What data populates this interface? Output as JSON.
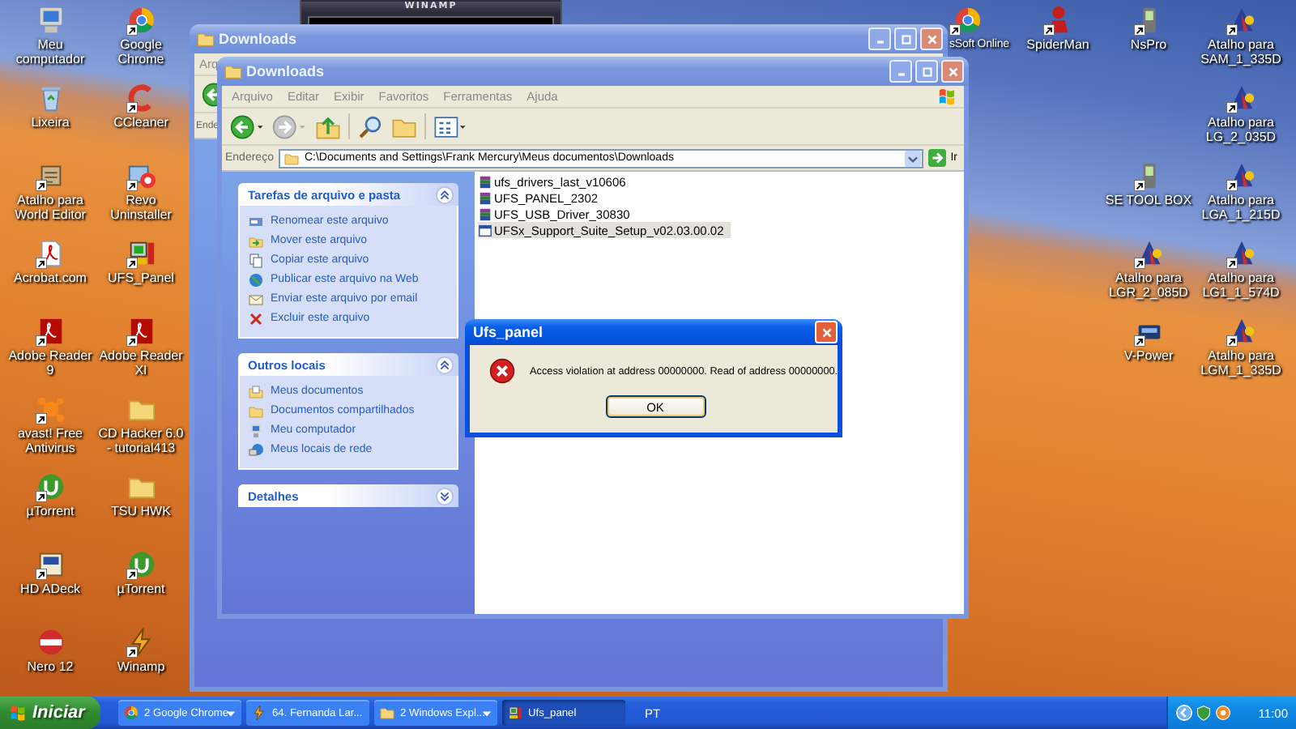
{
  "desktop_icons": [
    {
      "label": "Meu computador",
      "kind": "computer",
      "shortcut": false
    },
    {
      "label": "Google Chrome",
      "kind": "chrome",
      "shortcut": true
    },
    {
      "label": "Lixeira",
      "kind": "recycle-bin",
      "shortcut": false
    },
    {
      "label": "CCleaner",
      "kind": "ccleaner",
      "shortcut": true
    },
    {
      "label": "Atalho para World Editor",
      "kind": "scroll",
      "shortcut": true
    },
    {
      "label": "Revo Uninstaller",
      "kind": "uninstaller",
      "shortcut": true
    },
    {
      "label": "Acrobat.com",
      "kind": "acrobat",
      "shortcut": true
    },
    {
      "label": "UFS_Panel",
      "kind": "terminal",
      "shortcut": true
    },
    {
      "label": "Adobe Reader 9",
      "kind": "pdf",
      "shortcut": true
    },
    {
      "label": "Adobe Reader XI",
      "kind": "pdf",
      "shortcut": true
    },
    {
      "label": "avast! Free Antivirus",
      "kind": "avast",
      "shortcut": true
    },
    {
      "label": "CD Hacker 6.0 - tutorial413",
      "kind": "folder",
      "shortcut": false
    },
    {
      "label": "µTorrent",
      "kind": "utorrent",
      "shortcut": true
    },
    {
      "label": "TSU HWK",
      "kind": "folder",
      "shortcut": false
    },
    {
      "label": "HD ADeck",
      "kind": "card",
      "shortcut": true
    },
    {
      "label": "µTorrent",
      "kind": "utorrent",
      "shortcut": true
    },
    {
      "label": "Nero 12",
      "kind": "nero",
      "shortcut": false
    },
    {
      "label": "Winamp",
      "kind": "winamp",
      "shortcut": true
    },
    {
      "label": "sSoft Online",
      "kind": "chrome",
      "shortcut": true
    },
    {
      "label": "SpiderMan",
      "kind": "figure",
      "shortcut": true
    },
    {
      "label": "NsPro",
      "kind": "phone",
      "shortcut": true
    },
    {
      "label": "Atalho para SAM_1_335D",
      "kind": "atalho",
      "shortcut": true
    },
    {
      "label": "Atalho para LG_2_035D",
      "kind": "atalho",
      "shortcut": true
    },
    {
      "label": "SE TOOL BOX",
      "kind": "phone",
      "shortcut": true
    },
    {
      "label": "Atalho para LGA_1_215D",
      "kind": "atalho",
      "shortcut": true
    },
    {
      "label": "Atalho para LGR_2_085D",
      "kind": "atalho",
      "shortcut": true
    },
    {
      "label": "Atalho para LG1_1_574D",
      "kind": "atalho",
      "shortcut": true
    },
    {
      "label": "V-Power",
      "kind": "device",
      "shortcut": true
    },
    {
      "label": "Atalho para LGM_1_335D",
      "kind": "atalho",
      "shortcut": true
    }
  ],
  "winamp": {
    "title": "WINAMP"
  },
  "back_window": {
    "title": "Downloads",
    "menu": [
      "Arq"
    ],
    "address_label": "Ende"
  },
  "window": {
    "title": "Downloads",
    "menu": [
      "Arquivo",
      "Editar",
      "Exibir",
      "Favoritos",
      "Ferramentas",
      "Ajuda"
    ],
    "address": {
      "label": "Endereço",
      "value": "C:\\Documents and Settings\\Frank Mercury\\Meus documentos\\Downloads",
      "go": "Ir"
    },
    "sidebar": [
      {
        "title": "Tarefas de arquivo e pasta",
        "expanded": true,
        "items": [
          {
            "label": "Renomear este arquivo",
            "kind": "rename"
          },
          {
            "label": "Mover este arquivo",
            "kind": "move"
          },
          {
            "label": "Copiar este arquivo",
            "kind": "copy"
          },
          {
            "label": "Publicar este arquivo na Web",
            "kind": "publish"
          },
          {
            "label": "Enviar este arquivo por email",
            "kind": "email"
          },
          {
            "label": "Excluir este arquivo",
            "kind": "delete"
          }
        ]
      },
      {
        "title": "Outros locais",
        "expanded": true,
        "items": [
          {
            "label": "Meus documentos",
            "kind": "documents"
          },
          {
            "label": "Documentos compartilhados",
            "kind": "shared"
          },
          {
            "label": "Meu computador",
            "kind": "pc"
          },
          {
            "label": "Meus locais de rede",
            "kind": "network"
          }
        ]
      },
      {
        "title": "Detalhes",
        "expanded": false
      }
    ],
    "files": [
      {
        "name": "ufs_drivers_last_v10606",
        "kind": "archive",
        "selected": false
      },
      {
        "name": "UFS_PANEL_2302",
        "kind": "archive",
        "selected": false
      },
      {
        "name": "UFS_USB_Driver_30830",
        "kind": "archive",
        "selected": false
      },
      {
        "name": "UFSx_Support_Suite_Setup_v02.03.00.02",
        "kind": "installer",
        "selected": true
      }
    ]
  },
  "dialog": {
    "title": "Ufs_panel",
    "kind": "error",
    "message": "Access violation at address 00000000. Read of address 00000000.",
    "buttons": [
      "OK"
    ]
  },
  "taskbar": {
    "start": "Iniciar",
    "items": [
      {
        "label": "2 Google Chrome",
        "kind": "chrome",
        "grouped": true,
        "selected": false
      },
      {
        "label": "64. Fernanda Lar...",
        "kind": "winamp",
        "grouped": false,
        "selected": false
      },
      {
        "label": "2 Windows Expl...",
        "kind": "folder",
        "grouped": true,
        "selected": false
      },
      {
        "label": "Ufs_panel",
        "kind": "terminal",
        "grouped": false,
        "selected": true
      }
    ],
    "language": "PT",
    "clock": "11:00"
  }
}
